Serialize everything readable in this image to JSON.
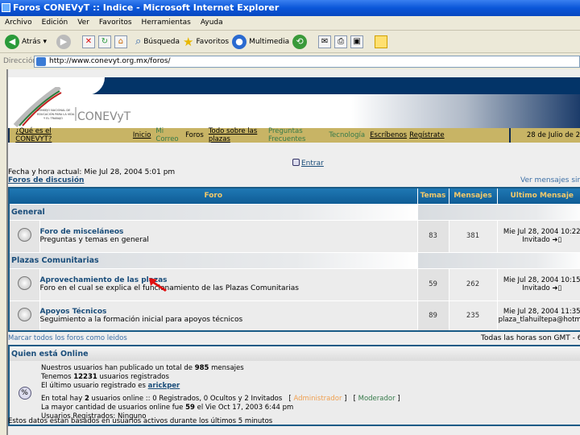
{
  "window": {
    "title": "Foros CONEVyT :: Indice - Microsoft Internet Explorer"
  },
  "menu": [
    "Archivo",
    "Edición",
    "Ver",
    "Favoritos",
    "Herramientas",
    "Ayuda"
  ],
  "toolbar": {
    "back": "Atrás",
    "search": "Búsqueda",
    "favorites": "Favoritos",
    "media": "Multimedia"
  },
  "address": {
    "label": "Dirección",
    "url": "http://www.conevyt.org.mx/foros/"
  },
  "header": {
    "logo_text": "CONEVyT",
    "logo_sub": "CONSEJO NACIONAL DE EDUCACIÓN PARA LA VIDA Y EL TRABAJO"
  },
  "nav": {
    "que_es": "¿Qué es el CONEVYT?",
    "items": [
      "Inicio",
      "Mi Correo",
      "Foros",
      "Todo sobre las plazas",
      "Preguntas Frecuentes",
      "Tecnología",
      "Escríbenos",
      "Regístrate"
    ],
    "date": "28 de Julio de 2"
  },
  "entrar": "Entrar",
  "fecha": "Fecha y hora actual: Mie Jul 28, 2004 5:01 pm",
  "foros_link": "Foros de discusión",
  "ver_sin_resp": "Ver mensajes sin res",
  "table": {
    "headers": [
      "Foro",
      "Temas",
      "Mensajes",
      "Ultimo Mensaje"
    ],
    "categories": [
      {
        "name": "General",
        "forums": [
          {
            "title": "Foro de misceláneos",
            "desc": "Preguntas y temas en general",
            "temas": "83",
            "mensajes": "381",
            "last_date": "Mie Jul 28, 2004 10:22",
            "last_user": "Invitado"
          }
        ]
      },
      {
        "name": "Plazas Comunitarias",
        "forums": [
          {
            "title": "Aprovechamiento de las plazas",
            "desc": "Foro en el cual se explica el funcionamiento de las Plazas Comunitarias",
            "temas": "59",
            "mensajes": "262",
            "last_date": "Mie Jul 28, 2004 10:15",
            "last_user": "Invitado"
          },
          {
            "title": "Apoyos Técnicos",
            "desc": "Seguimiento a la formación inicial para apoyos técnicos",
            "temas": "89",
            "mensajes": "235",
            "last_date": "Mie Jul 28, 2004 11:35",
            "last_user": "plaza_tlahuiltepa@hotma"
          }
        ]
      }
    ]
  },
  "marcar": "Marcar todos los foros como leidos",
  "gmt": "Todas las horas son GMT - 6",
  "online": {
    "title": "Quien está Online",
    "l1a": "Nuestros usuarios han publicado un total de ",
    "posts": "985",
    "l1b": " mensajes",
    "l2a": "Tenemos ",
    "users": "12231",
    "l2b": " usuarios registrados",
    "l3a": "El último usuario registrado es ",
    "newest": "arickper",
    "l4a": "En total hay ",
    "online_count": "2",
    "l4b": " usuarios online :: 0 Registrados, 0 Ocultos y 2 Invitados   [ ",
    "admin": "Administrador",
    "l4c": " ]   [ ",
    "mod": "Moderador",
    "l4d": " ]",
    "l5a": "La mayor cantidad de usuarios online fue ",
    "max": "59",
    "l5b": " el Vie Oct 17, 2003 6:44 pm",
    "l6": "Usuarios Registrados: Ninguno"
  },
  "footnote": "Estos datos estan basados en usuarios activos durante los últimos 5 minutos",
  "colors": {
    "table_border": "#1a5b86",
    "header_gold": "#f3c96a",
    "nav_gold": "#c8b465",
    "admin": "#f0a050",
    "mod": "#367a4a"
  }
}
